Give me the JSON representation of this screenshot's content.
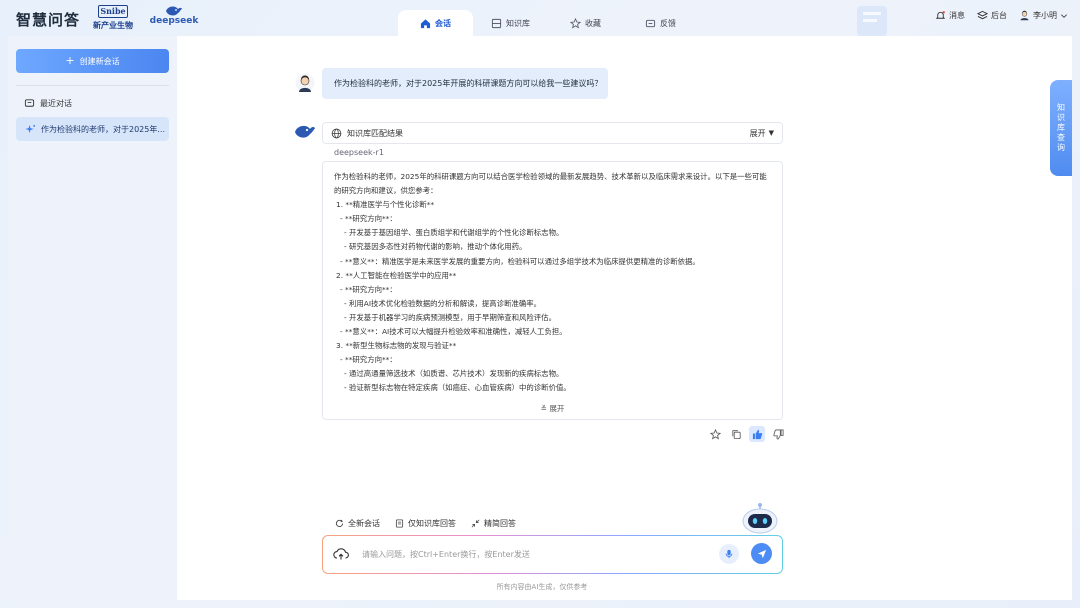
{
  "app": {
    "title": "智慧问答",
    "partner_logo_text": "Snibe",
    "partner_logo_sub": "新产业生物",
    "model_logo_text": "deepseek"
  },
  "tabs": [
    {
      "label": "会话",
      "icon": "home-icon",
      "active": true
    },
    {
      "label": "知识库",
      "icon": "database-icon",
      "active": false
    },
    {
      "label": "收藏",
      "icon": "star-icon",
      "active": false
    },
    {
      "label": "反馈",
      "icon": "message-icon",
      "active": false
    }
  ],
  "top_right": {
    "messages": "消息",
    "backend": "后台",
    "user_name": "李小明"
  },
  "sidebar": {
    "new_chat": "创建新会话",
    "recent_title": "最近对话",
    "conversations": [
      "作为检验科的老师，对于2025年..."
    ],
    "collapse_icon": "«"
  },
  "chat": {
    "user_question": "作为检验科的老师，对于2025年开展的科研课题方向可以给我一些建议吗？",
    "kb_title": "知识库匹配结果",
    "kb_expand": "展开",
    "model_name": "deepseek-r1",
    "answer_intro": "作为检验科的老师，2025年的科研课题方向可以结合医学检验领域的最新发展趋势、技术革新以及临床需求来设计。以下是一些可能的研究方向和建议，供您参考：",
    "answer_lines": [
      {
        "level": 1,
        "text": "1. **精准医学与个性化诊断**"
      },
      {
        "level": 2,
        "text": "- **研究方向**："
      },
      {
        "level": 3,
        "text": "- 开发基于基因组学、蛋白质组学和代谢组学的个性化诊断标志物。"
      },
      {
        "level": 3,
        "text": "- 研究基因多态性对药物代谢的影响，推动个体化用药。"
      },
      {
        "level": 2,
        "text": "- **意义**：精准医学是未来医学发展的重要方向，检验科可以通过多组学技术为临床提供更精准的诊断依据。"
      },
      {
        "level": 1,
        "text": "2. **人工智能在检验医学中的应用**"
      },
      {
        "level": 2,
        "text": "- **研究方向**："
      },
      {
        "level": 3,
        "text": "- 利用AI技术优化检验数据的分析和解读，提高诊断准确率。"
      },
      {
        "level": 3,
        "text": "- 开发基于机器学习的疾病预测模型，用于早期筛查和风险评估。"
      },
      {
        "level": 2,
        "text": "- **意义**：AI技术可以大幅提升检验效率和准确性，减轻人工负担。"
      },
      {
        "level": 1,
        "text": "3. **新型生物标志物的发现与验证**"
      },
      {
        "level": 2,
        "text": "- **研究方向**："
      },
      {
        "level": 3,
        "text": "- 通过高通量筛选技术（如质谱、芯片技术）发现新的疾病标志物。"
      },
      {
        "level": 3,
        "text": "- 验证新型标志物在特定疾病（如癌症、心血管疾病）中的诊断价值。"
      }
    ],
    "answer_expand": "展开"
  },
  "quick_actions": [
    {
      "label": "全新会话",
      "icon": "refresh-icon"
    },
    {
      "label": "仅知识库回答",
      "icon": "book-icon"
    },
    {
      "label": "精简回答",
      "icon": "compress-icon"
    }
  ],
  "input": {
    "placeholder": "请输入问题，按Ctrl+Enter换行，按Enter发送"
  },
  "footnote": "所有内容由AI生成，仅供参考",
  "right_tab": "知识库查询",
  "colors": {
    "accent": "#4c8cf5",
    "bubble": "#e3edfb",
    "selected": "#d7e5fb"
  }
}
